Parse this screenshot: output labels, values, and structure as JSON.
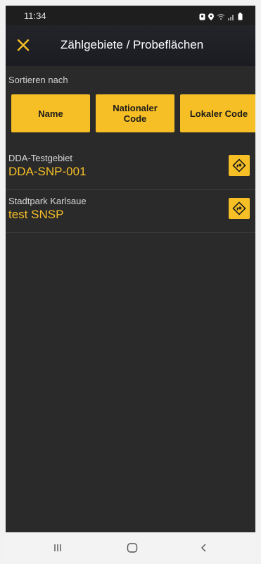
{
  "status_bar": {
    "time": "11:34",
    "icons": [
      "notification-icon",
      "location-icon",
      "wifi-icon",
      "signal-icon",
      "battery-icon"
    ]
  },
  "toolbar": {
    "close_icon": "close-icon",
    "title": "Zählgebiete / Probeflächen"
  },
  "sort": {
    "label": "Sortieren nach",
    "buttons": [
      {
        "label": "Name"
      },
      {
        "label": "Nationaler Code"
      },
      {
        "label": "Lokaler Code"
      }
    ]
  },
  "areas": [
    {
      "name": "DDA-Testgebiet",
      "code": "DDA-SNP-001",
      "action_icon": "directions-icon"
    },
    {
      "name": "Stadtpark Karlsaue",
      "code": "test SNSP",
      "action_icon": "directions-icon"
    }
  ],
  "nav_bar": {
    "buttons": [
      "recent-apps-icon",
      "home-icon",
      "back-icon"
    ]
  },
  "colors": {
    "accent": "#f7bf26",
    "background": "#2a2a2b",
    "toolbar": "#1f2026"
  }
}
